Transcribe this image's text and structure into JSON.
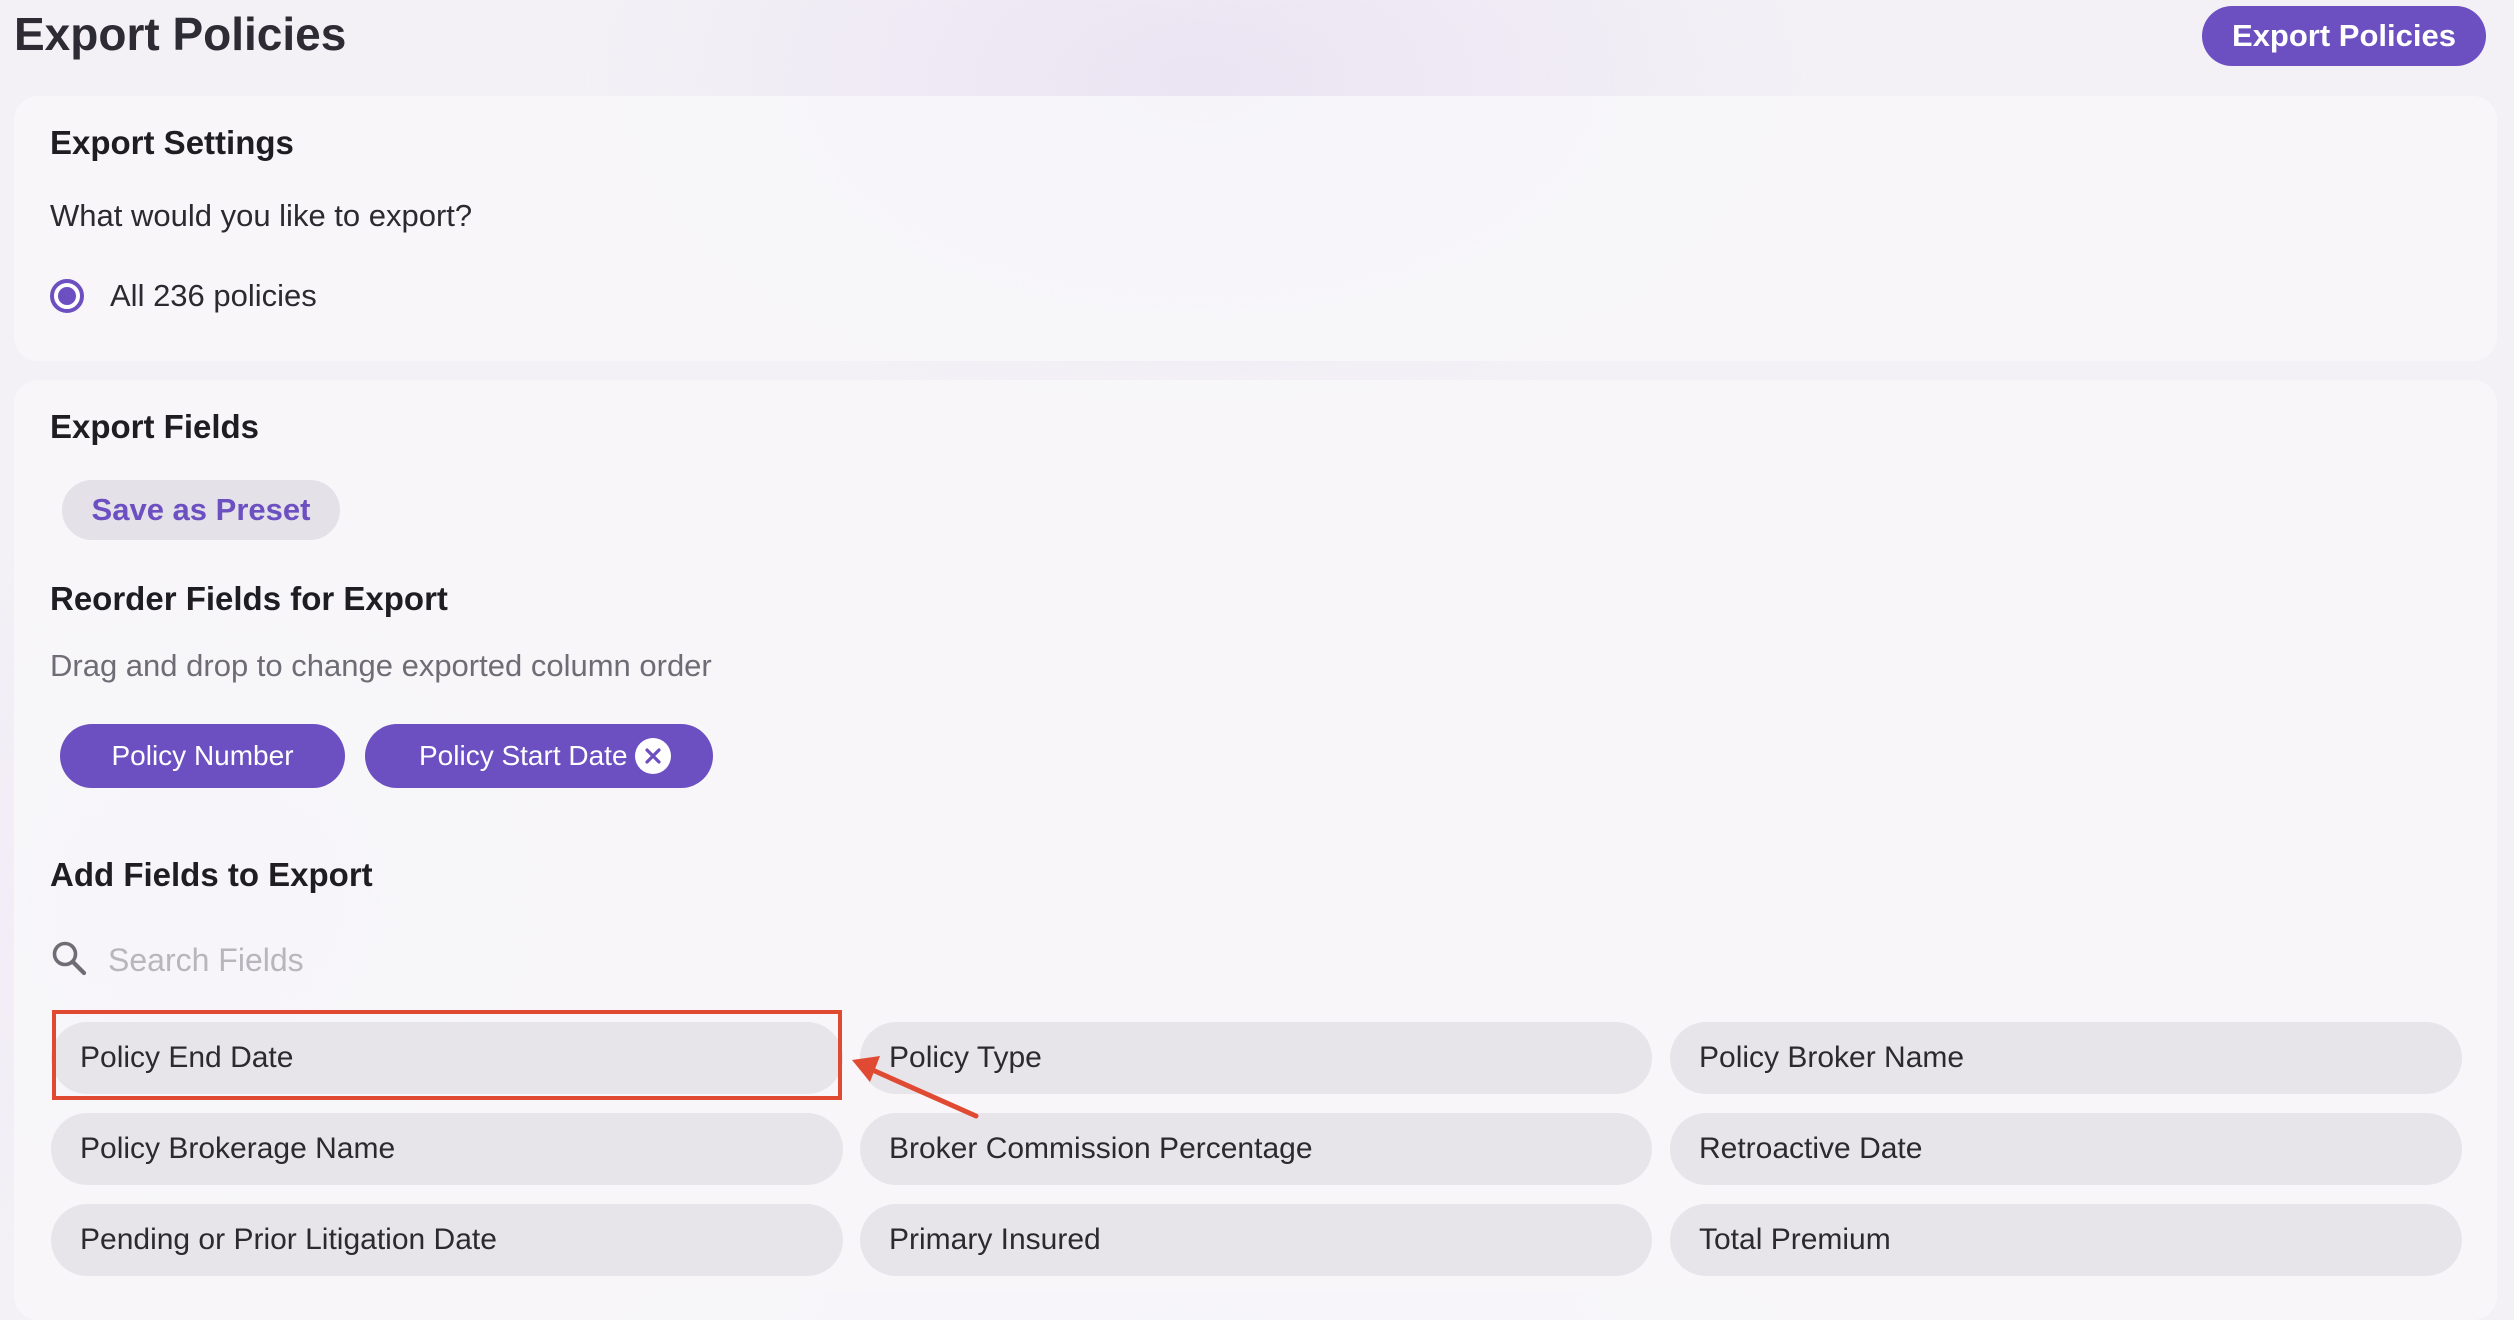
{
  "header": {
    "title": "Export Policies",
    "export_button": "Export Policies"
  },
  "settings": {
    "title": "Export Settings",
    "question": "What would you like to export?",
    "option_label": "All 236 policies",
    "option_selected": true
  },
  "fields_section": {
    "title": "Export Fields",
    "save_preset": "Save as Preset",
    "reorder_title": "Reorder Fields for Export",
    "reorder_hint": "Drag and drop to change exported column order",
    "selected": [
      "Policy Number",
      "Policy Start Date"
    ],
    "add_title": "Add Fields to Export",
    "search_placeholder": "Search Fields",
    "available": [
      "Policy End Date",
      "Policy Type",
      "Policy Broker Name",
      "Policy Brokerage Name",
      "Broker Commission Percentage",
      "Retroactive Date",
      "Pending or Prior Litigation Date",
      "Primary Insured",
      "Total Premium"
    ]
  },
  "icons": {
    "search": "search-icon",
    "remove": "close-circle-icon",
    "radio": "radio-selected-icon"
  },
  "colors": {
    "accent": "#6c4fc1",
    "annotation": "#e04a33",
    "pill_bg": "#e7e5ea"
  }
}
